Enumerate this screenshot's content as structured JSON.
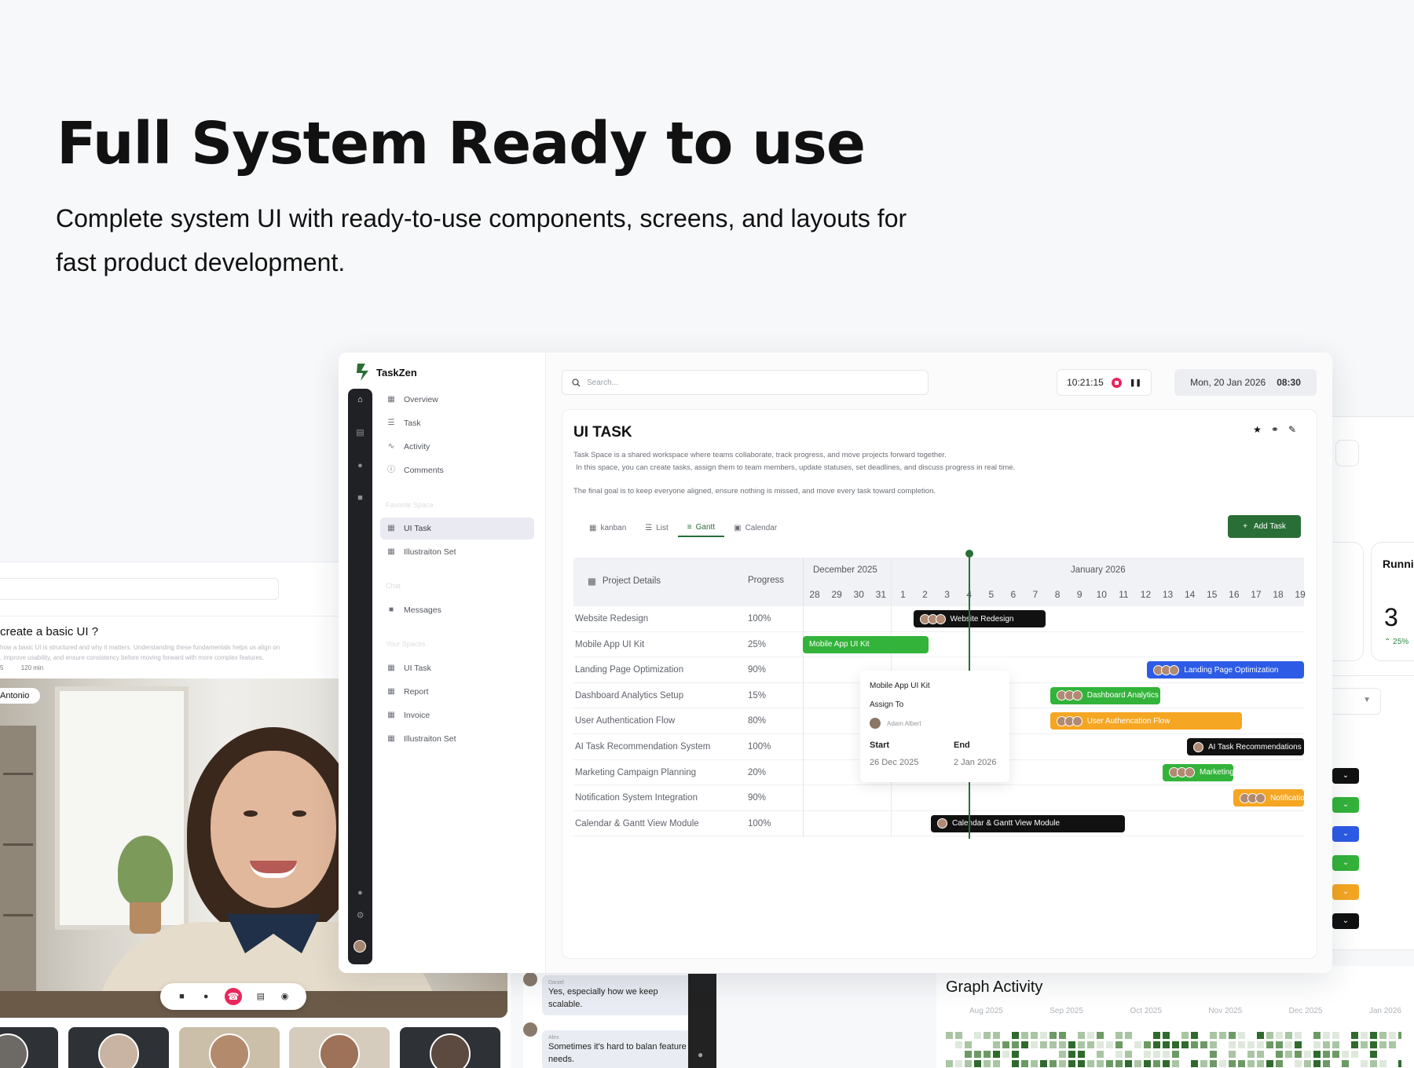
{
  "hero": {
    "title": "Full System Ready to use",
    "subtitle": "Complete system UI with ready-to-use components, screens, and layouts for fast product development."
  },
  "video_panel": {
    "question": "create a basic UI ?",
    "description": "how a basic UI is structured and why it matters. Understanding these fundamentals helps us align on , improve usability, and ensure consistency before moving forward with more complex features.",
    "meta": [
      "5",
      "120 min"
    ],
    "participant": "Antonio"
  },
  "chat": {
    "messages": [
      {
        "who": "Daniel",
        "text": "Yes, especially how we keep scalable."
      },
      {
        "who": "Alex",
        "text": "Sometimes it's hard to balan feature needs."
      }
    ]
  },
  "right_panel": {
    "running_label": "Runni",
    "running_value": "3",
    "running_change": "25%",
    "graph_title": "Graph Activity",
    "graph_months": [
      "Aug 2025",
      "Sep 2025",
      "Oct 2025",
      "Nov 2025",
      "Dec 2025",
      "Jan 2026"
    ],
    "chevron_colors": [
      "#111111",
      "#33b33a",
      "#2d5be6",
      "#33b33a",
      "#f5a623",
      "#111111"
    ]
  },
  "app": {
    "brand": "TaskZen",
    "nav": [
      {
        "label": "Overview",
        "icon": "grid-icon"
      },
      {
        "label": "Task",
        "icon": "checklist-icon"
      },
      {
        "label": "Activity",
        "icon": "activity-icon"
      },
      {
        "label": "Comments",
        "icon": "info-icon"
      }
    ],
    "section_favorite": "Favorite Space",
    "favorites": [
      {
        "label": "UI Task",
        "active": true
      },
      {
        "label": "Illustraiton Set",
        "active": false
      }
    ],
    "section_chat": "Chat",
    "chat_item": "Messages",
    "section_spaces": "Your Spaces",
    "spaces": [
      "UI Task",
      "Report",
      "Invoice",
      "Illustraiton Set"
    ],
    "search_placeholder": "Search...",
    "timer": "10:21:15",
    "date": "Mon, 20 Jan 2026",
    "time": "08:30"
  },
  "task": {
    "title": "UI TASK",
    "desc_line1": "Task Space is a shared workspace where teams collaborate, track progress, and move projects forward together.",
    "desc_line2": "In this space, you can create tasks, assign them to team members, update statuses, set deadlines, and discuss progress in real time.",
    "goal": "The final goal is to keep everyone aligned, ensure nothing is missed, and move every task toward completion.",
    "tabs": [
      {
        "label": "kanban",
        "icon": "kanban-icon",
        "active": false
      },
      {
        "label": "List",
        "icon": "list-icon",
        "active": false
      },
      {
        "label": "Gantt",
        "icon": "gantt-icon",
        "active": true
      },
      {
        "label": "Calendar",
        "icon": "calendar-icon",
        "active": false
      }
    ],
    "add_task": "Add Task"
  },
  "gantt": {
    "col_project": "Project Details",
    "col_progress": "Progress",
    "month_dec": "December 2025",
    "month_jan": "January 2026",
    "days": [
      "28",
      "29",
      "30",
      "31",
      "1",
      "2",
      "3",
      "4",
      "5",
      "6",
      "7",
      "8",
      "9",
      "10",
      "11",
      "12",
      "13",
      "14",
      "15",
      "16",
      "17",
      "18",
      "19"
    ],
    "rows": [
      {
        "name": "Website Redesign",
        "progress": "100%",
        "bar": "Website Redesign",
        "color": "#111111",
        "start": 5,
        "span": 6,
        "avatars": 3
      },
      {
        "name": "Mobile App UI Kit",
        "progress": "25%",
        "bar": "Mobile App UI Kit",
        "color": "#33b33a",
        "start": 0,
        "span": 5.7,
        "avatars": 0
      },
      {
        "name": "Landing Page Optimization",
        "progress": "90%",
        "bar": "Landing Page Optimization",
        "color": "#2d5be6",
        "start": 15.6,
        "span": 7.4,
        "avatars": 3
      },
      {
        "name": "Dashboard Analytics Setup",
        "progress": "15%",
        "bar": "Dashboard Analytics Setup",
        "color": "#33b33a",
        "start": 11.2,
        "span": 5,
        "avatars": 3
      },
      {
        "name": "User Authentication Flow",
        "progress": "80%",
        "bar": "User Authencation Flow",
        "color": "#f5a623",
        "start": 11.2,
        "span": 8.7,
        "avatars": 3
      },
      {
        "name": "AI Task Recommendation System",
        "progress": "100%",
        "bar": "AI Task Recommendations",
        "color": "#111111",
        "start": 17.4,
        "span": 5.6,
        "avatars": 1
      },
      {
        "name": "Marketing Campaign Planning",
        "progress": "20%",
        "bar": "Marketing Campaign Planning",
        "color": "#33b33a",
        "start": 16.3,
        "span": 3.2,
        "avatars": 3
      },
      {
        "name": "Notification System Integration",
        "progress": "90%",
        "bar": "Notification System Integration",
        "color": "#f5a623",
        "start": 19.5,
        "span": 3.5,
        "avatars": 3
      },
      {
        "name": "Calendar & Gantt View Module",
        "progress": "100%",
        "bar": "Calendar & Gantt View Module",
        "color": "#111111",
        "start": 5.8,
        "span": 8.8,
        "avatars": 1
      }
    ],
    "popover": {
      "title": "Mobile App UI Kit",
      "assign_label": "Assign To",
      "assignee": "Adam Albert",
      "start_label": "Start",
      "end_label": "End",
      "start": "26 Dec 2025",
      "end": "2 Jan 2026"
    }
  }
}
